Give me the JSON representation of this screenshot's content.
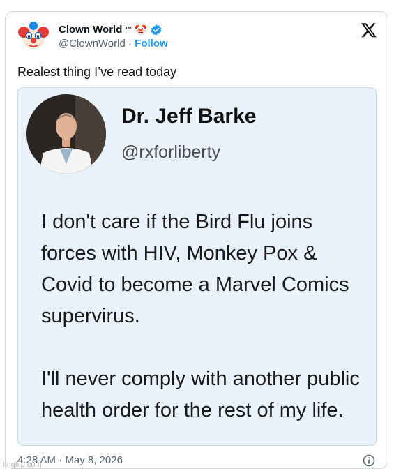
{
  "author": {
    "name": "Clown World",
    "trademark": "™",
    "emoji": "🤡",
    "handle": "@ClownWorld",
    "separator": "·",
    "follow_label": "Follow"
  },
  "tweet": {
    "text": "Realest thing I’ve read today",
    "timestamp": "4:28 AM · May 8, 2026"
  },
  "embedded_post": {
    "name": "Dr. Jeff Barke",
    "handle": "@rxforliberty",
    "paragraphs": [
      "I don't care if the Bird Flu joins forces with HIV, Monkey Pox & Covid to become a Marvel Comics supervirus.",
      "I'll never comply with another public health order for the rest of my life."
    ]
  },
  "watermark": "imgflip.com",
  "colors": {
    "accent": "#1d9bf0",
    "embed_background": "#e9f1fa",
    "secondary_text": "#536471"
  },
  "icons": [
    "clown-avatar-icon",
    "verified-badge-icon",
    "x-logo-icon",
    "info-icon"
  ]
}
